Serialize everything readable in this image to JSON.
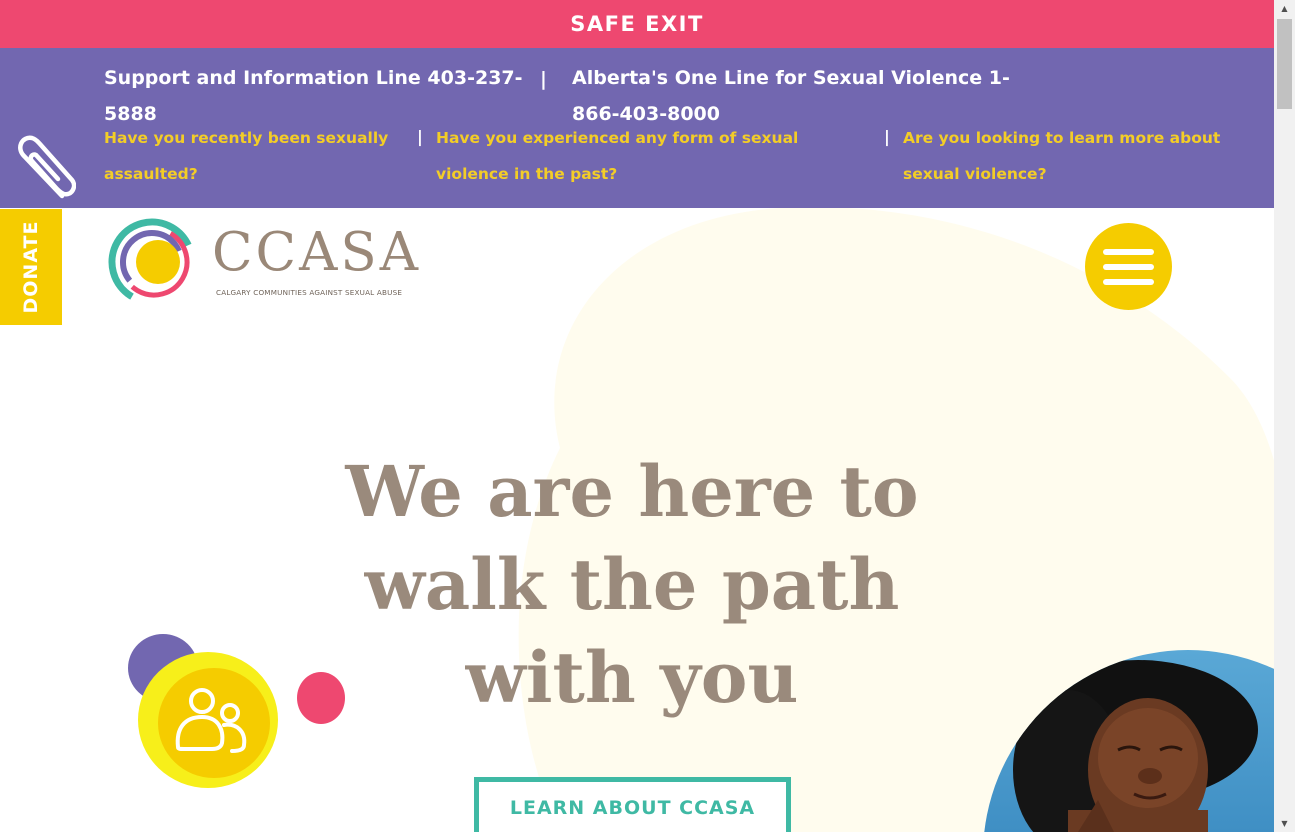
{
  "safe_exit": {
    "label": "SAFE EXIT"
  },
  "info_bar": {
    "icon": "paperclip-icon",
    "lines": [
      "Support and Information Line 403-237-5888",
      "Alberta's One Line for Sexual Violence 1-866-403-8000"
    ],
    "questions": [
      "Have you recently been sexually assaulted?",
      "Have you experienced any form of sexual violence in the past?",
      "Are you looking to learn more about sexual violence?"
    ],
    "separator": "|"
  },
  "donate": {
    "label": "DONATE"
  },
  "logo": {
    "wordmark": "CCASA",
    "tagline": "CALGARY COMMUNITIES AGAINST SEXUAL ABUSE"
  },
  "menu": {
    "icon": "hamburger-icon"
  },
  "hero": {
    "title_lines": [
      "We are here to",
      "walk the path",
      "with you"
    ],
    "cta_label": "LEARN ABOUT CCASA"
  },
  "decoration": {
    "icon": "people-icon"
  },
  "colors": {
    "pink": "#ee4870",
    "purple": "#7267b0",
    "yellow": "#f5cc00",
    "question_yellow": "#f3cd27",
    "teal": "#3fb9a4",
    "taupe": "#9a8a7c",
    "cream": "#fffcee"
  }
}
